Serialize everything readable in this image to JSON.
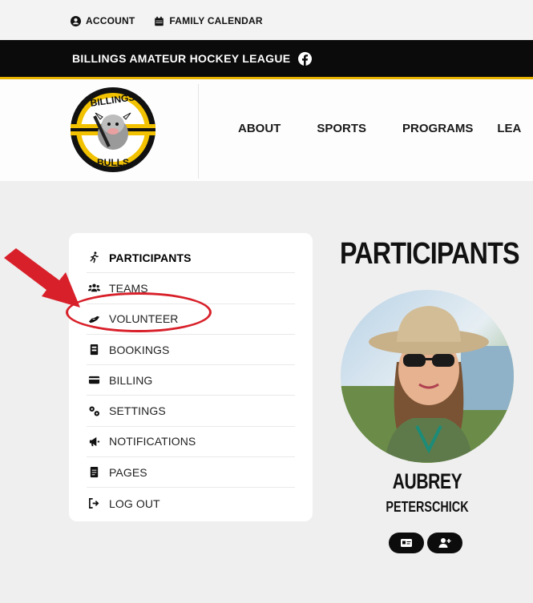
{
  "topbar": {
    "account_label": "ACCOUNT",
    "calendar_label": "FAMILY CALENDAR"
  },
  "league": {
    "name": "BILLINGS AMATEUR HOCKEY LEAGUE",
    "accent_color": "#e8b400"
  },
  "logo": {
    "top_text": "BILLINGS",
    "bottom_text": "BULLS"
  },
  "nav": {
    "items": [
      {
        "label": "ABOUT"
      },
      {
        "label": "SPORTS"
      },
      {
        "label": "PROGRAMS"
      },
      {
        "label": "LEA"
      }
    ]
  },
  "sidebar": {
    "items": [
      {
        "label": "PARTICIPANTS",
        "icon": "running-person-icon",
        "active": true
      },
      {
        "label": "TEAMS",
        "icon": "users-icon"
      },
      {
        "label": "VOLUNTEER",
        "icon": "hands-helping-icon"
      },
      {
        "label": "BOOKINGS",
        "icon": "booking-icon"
      },
      {
        "label": "BILLING",
        "icon": "credit-card-icon"
      },
      {
        "label": "SETTINGS",
        "icon": "gears-icon"
      },
      {
        "label": "NOTIFICATIONS",
        "icon": "megaphone-icon"
      },
      {
        "label": "PAGES",
        "icon": "page-icon"
      },
      {
        "label": "LOG OUT",
        "icon": "logout-icon"
      }
    ]
  },
  "participant_panel": {
    "title": "PARTICIPANTS",
    "first_name": "AUBREY",
    "last_name": "PETERSCHICK"
  },
  "annotation": {
    "color": "#d8202a"
  }
}
